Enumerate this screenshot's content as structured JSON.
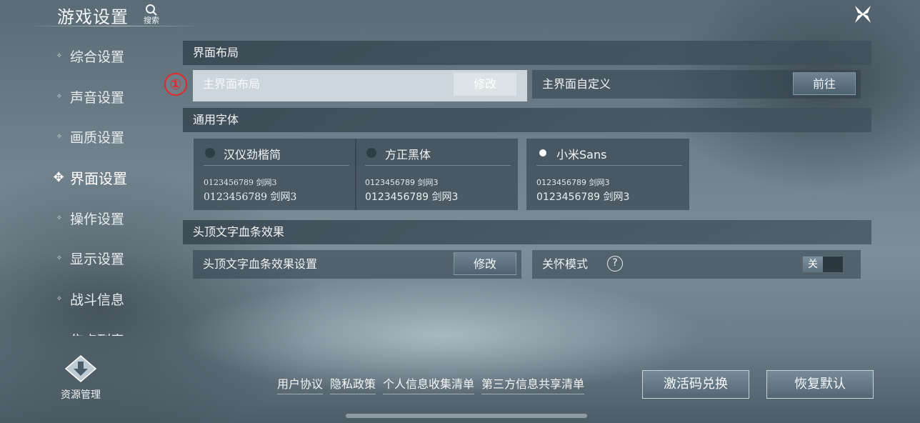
{
  "header": {
    "title": "游戏设置",
    "search_label": "搜索"
  },
  "sidebar": {
    "items": [
      {
        "label": "综合设置",
        "active": false
      },
      {
        "label": "声音设置",
        "active": false
      },
      {
        "label": "画质设置",
        "active": false
      },
      {
        "label": "界面设置",
        "active": true
      },
      {
        "label": "操作设置",
        "active": false
      },
      {
        "label": "显示设置",
        "active": false
      },
      {
        "label": "战斗信息",
        "active": false
      },
      {
        "label": "焦点列表",
        "active": false
      }
    ],
    "resource_label": "资源管理"
  },
  "layout_section": {
    "title": "界面布局",
    "badge": "①",
    "main_layout_label": "主界面布局",
    "main_layout_button": "修改",
    "custom_label": "主界面自定义",
    "custom_button": "前往"
  },
  "font_section": {
    "title": "通用字体",
    "options": [
      {
        "name": "汉仪劲楷简",
        "sample_small": "0123456789 剑网3",
        "sample_large": "0123456789 剑网3",
        "selected": false
      },
      {
        "name": "方正黑体",
        "sample_small": "0123456789 剑网3",
        "sample_large": "0123456789 剑网3",
        "selected": false
      },
      {
        "name": "小米Sans",
        "sample_small": "0123456789 剑网3",
        "sample_large": "0123456789 剑网3",
        "selected": true
      }
    ]
  },
  "hp_section": {
    "title": "头顶文字血条效果",
    "setting_label": "头顶文字血条效果设置",
    "setting_button": "修改",
    "care_label": "关怀模式",
    "care_help": "?",
    "care_toggle": "关"
  },
  "footer": {
    "links": [
      "用户协议",
      "隐私政策",
      "个人信息收集清单",
      "第三方信息共享清单"
    ],
    "redeem_button": "激活码兑换",
    "reset_button": "恢复默认"
  },
  "icons": {
    "search": "search-icon",
    "close": "close-icon",
    "resource": "download-diamond-icon"
  }
}
